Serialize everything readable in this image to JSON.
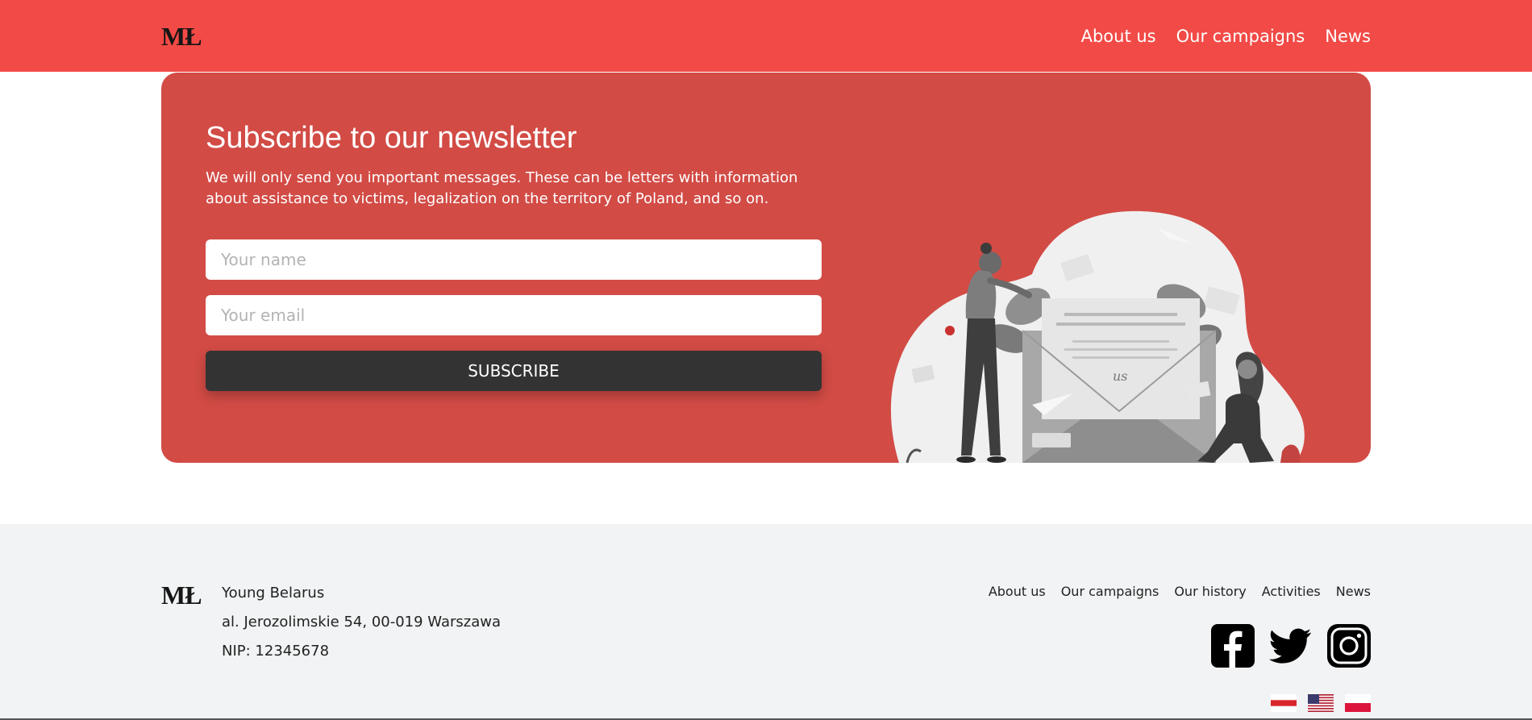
{
  "header": {
    "logo": "MŁ",
    "nav": [
      "About us",
      "Our campaigns",
      "News"
    ]
  },
  "newsletter": {
    "title": "Subscribe to our newsletter",
    "description": "We will only send you important messages. These can be letters with information about assistance to victims, legalization on the territory of Poland, and so on.",
    "name_placeholder": "Your name",
    "email_placeholder": "Your email",
    "button_label": "SUBSCRIBE",
    "illustration_text": "us"
  },
  "footer": {
    "logo": "MŁ",
    "org_name": "Young Belarus",
    "address": "al. Jerozolimskie 54, 00-019 Warszawa",
    "nip": "NIP: 12345678",
    "nav": [
      "About us",
      "Our campaigns",
      "Our history",
      "Activities",
      "News"
    ],
    "socials": [
      "facebook-icon",
      "twitter-icon",
      "instagram-icon"
    ],
    "languages": [
      "belarus-flag",
      "usa-flag",
      "poland-flag"
    ]
  },
  "colors": {
    "header_bg": "#f24a46",
    "card_bg": "#d24b45",
    "button_bg": "#333333",
    "footer_bg": "#f2f3f4"
  }
}
